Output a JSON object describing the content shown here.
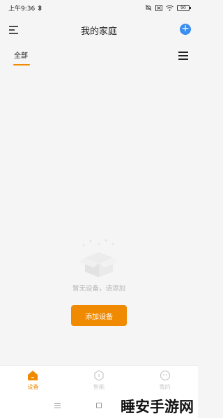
{
  "status_bar": {
    "time": "上午9:36",
    "battery": "90"
  },
  "header": {
    "title": "我的家庭"
  },
  "tabs": {
    "all_label": "全部"
  },
  "empty_state": {
    "message": "暂无设备，请添加",
    "button_label": "添加设备"
  },
  "bottom_nav": {
    "items": [
      {
        "label": "设备",
        "icon": "home-icon",
        "active": true
      },
      {
        "label": "智能",
        "icon": "smart-icon",
        "active": false
      },
      {
        "label": "我的",
        "icon": "profile-icon",
        "active": false
      }
    ]
  },
  "watermark": "睡安手游网",
  "colors": {
    "accent": "#f08a00",
    "add_button": "#3a8ef0",
    "inactive": "#c9c9c9"
  }
}
